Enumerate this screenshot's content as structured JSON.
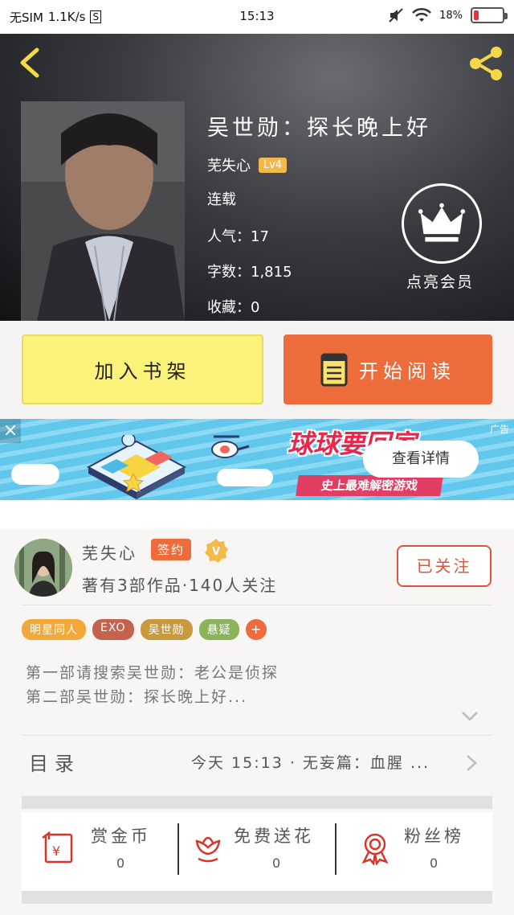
{
  "status_bar": {
    "carrier": "无SIM",
    "speed": "1.1K/s",
    "s_icon": "S",
    "time": "15:13",
    "battery": "18%",
    "battery_level": 0.18
  },
  "book": {
    "title": "吴世勋：探长晚上好",
    "author": "芜失心",
    "level": "Lv4",
    "status": "连载",
    "popularity": "人气：17",
    "word_count": "字数：1,815",
    "favorites": "收藏：0",
    "vip_label": "点亮会员"
  },
  "actions": {
    "add_shelf": "加入书架",
    "start_read": "开始阅读"
  },
  "ad": {
    "close": "×",
    "tag": "广告",
    "title": "球球要回家",
    "ribbon": "史上最难解密游戏",
    "cta": "查看详情"
  },
  "author_card": {
    "name": "芜失心",
    "signed": "签约",
    "v_badge": "V",
    "stats": "著有3部作品·140人关注",
    "follow": "已关注",
    "tags": [
      {
        "label": "明星同人",
        "color": "#f3a93a"
      },
      {
        "label": "EXO",
        "color": "#c4624b"
      },
      {
        "label": "吴世勋",
        "color": "#c99a3d"
      },
      {
        "label": "悬疑",
        "color": "#8bb35c"
      }
    ],
    "tag_more": "+",
    "intro_lines": [
      "第一部请搜索吴世勋：老公是侦探",
      "第二部吴世勋：探长晚上好..."
    ]
  },
  "toc": {
    "label": "目录",
    "latest": "今天 15:13 · 无妄篇：血腥 ..."
  },
  "support": {
    "items": [
      {
        "label": "赏金币",
        "value": "0",
        "icon": "coin-envelope-icon"
      },
      {
        "label": "免费送花",
        "value": "0",
        "icon": "flower-icon"
      },
      {
        "label": "粉丝榜",
        "value": "0",
        "icon": "medal-icon"
      }
    ]
  },
  "colors": {
    "accent_orange": "#ec6c3c",
    "shelf_yellow": "#fbf27a",
    "badge_gold": "#f3b94a"
  }
}
